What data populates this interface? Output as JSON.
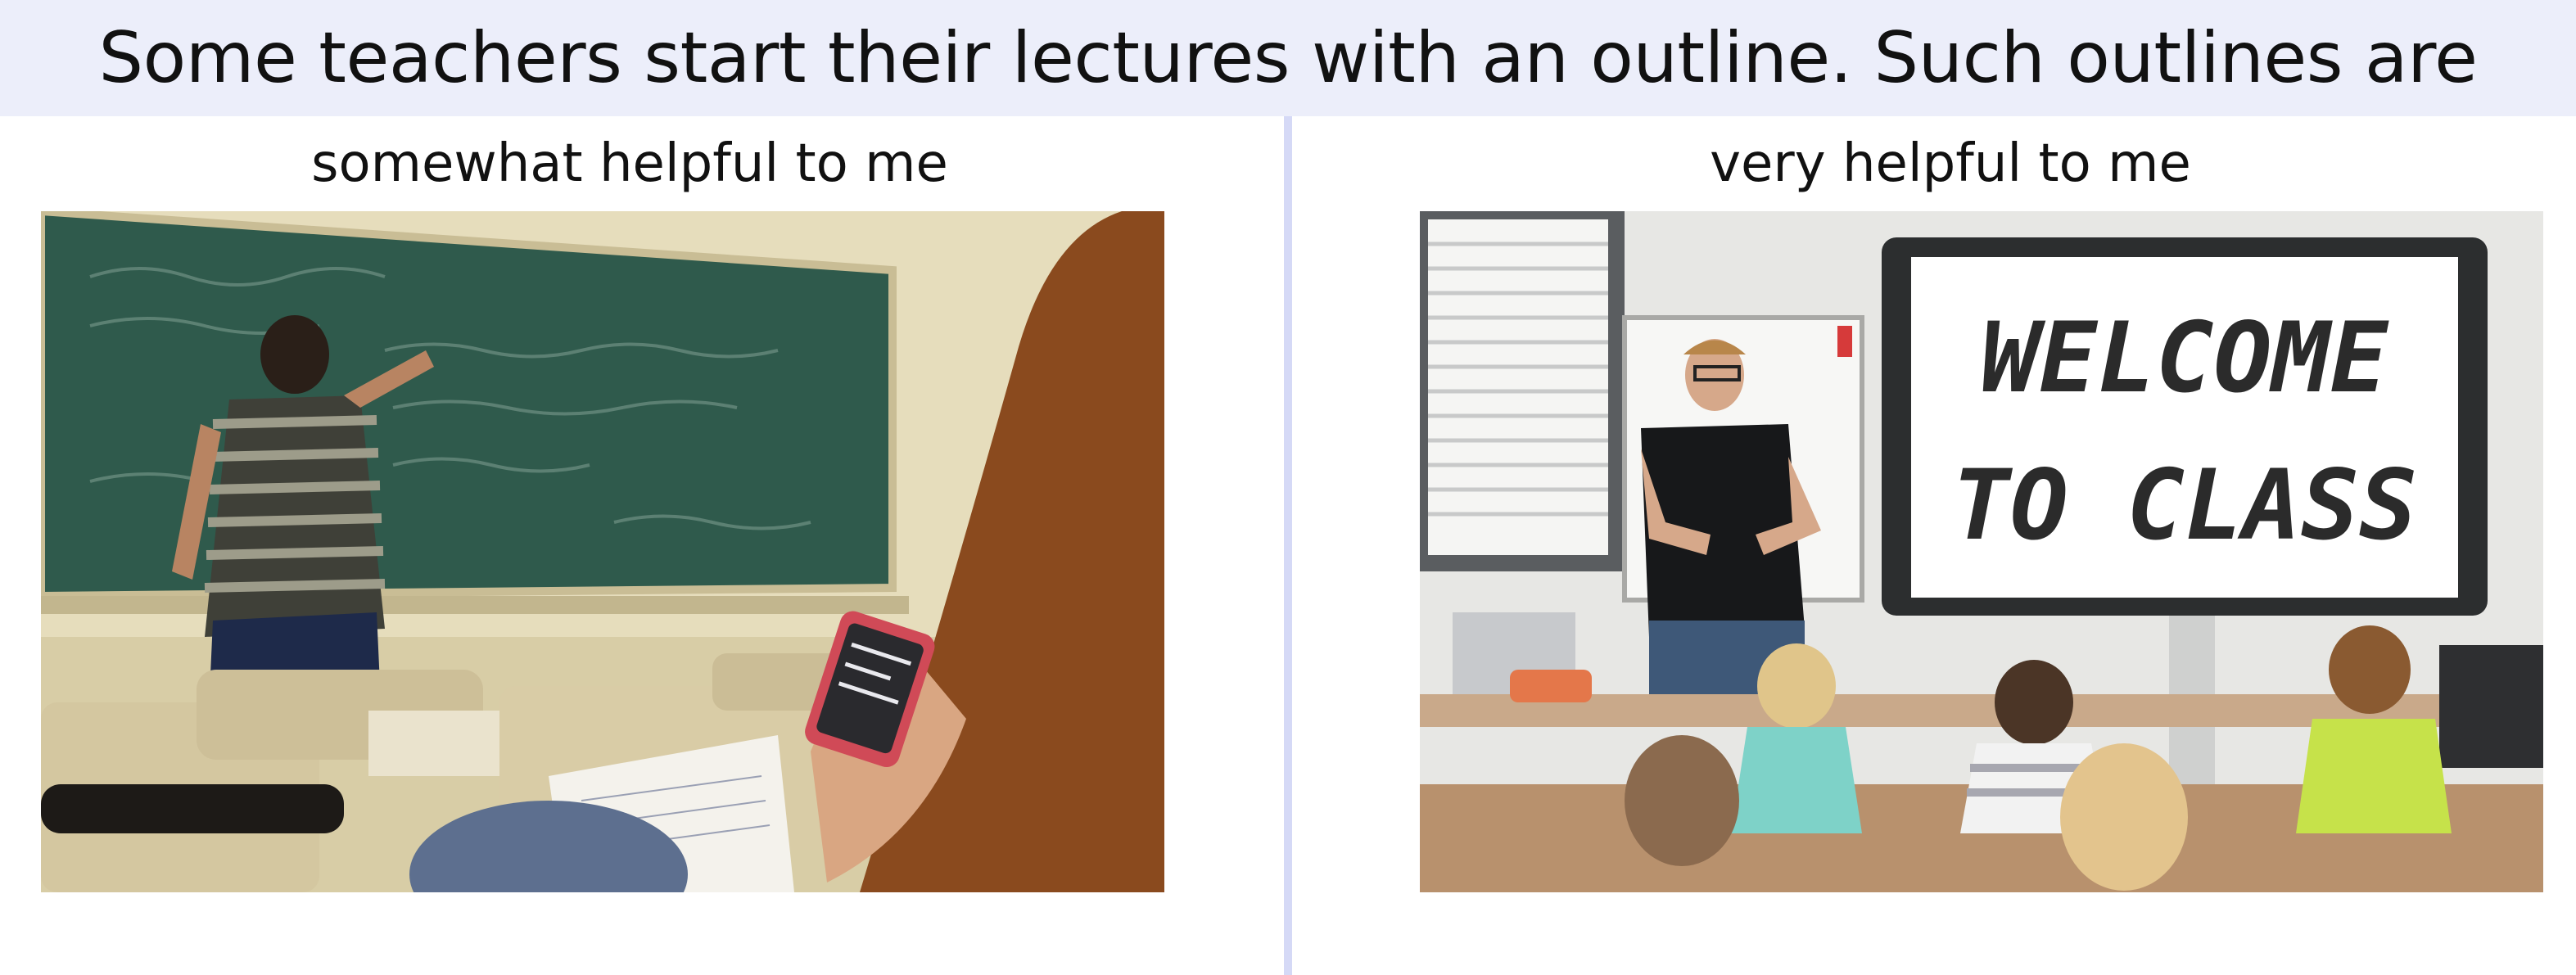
{
  "survey": {
    "question": "Some teachers start their lectures with an outline. Such outlines are",
    "options": [
      {
        "label": "somewhat helpful to me",
        "image_alt": "student using phone while teacher writes on chalkboard"
      },
      {
        "label": "very helpful to me",
        "image_alt": "teacher presenting next to smartboard"
      }
    ],
    "smartboard": {
      "line1": "WELCOME",
      "line2": "TO CLASS"
    }
  },
  "colors": {
    "header_bg": "#eceefa",
    "divider": "#d5d9f6",
    "chalkboard": "#2f5a4c"
  }
}
